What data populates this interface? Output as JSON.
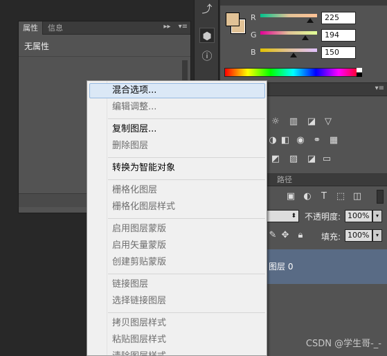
{
  "properties_panel": {
    "tabs": [
      "属性",
      "信息"
    ],
    "expand_glyph": "▸▸",
    "menu_glyph": "▾≡",
    "label": "无属性"
  },
  "color_panel": {
    "channels": [
      {
        "name": "R",
        "value": "225"
      },
      {
        "name": "G",
        "value": "194"
      },
      {
        "name": "B",
        "value": "150"
      }
    ],
    "foreground_color": "#e1c296",
    "menu_glyph": "▾≡"
  },
  "adjustments_panel": {
    "menu_glyph": "▾≡"
  },
  "layers_panel": {
    "tab": "路径",
    "opacity_label": "不透明度:",
    "opacity_value": "100%",
    "fill_label": "填充:",
    "fill_value": "100%",
    "layer_name": "图层 0"
  },
  "context_menu": {
    "items": [
      {
        "label": "混合选项...",
        "disabled": false
      },
      {
        "label": "编辑调整...",
        "disabled": true
      },
      {
        "label": "复制图层...",
        "disabled": false
      },
      {
        "label": "删除图层",
        "disabled": true
      },
      {
        "label": "转换为智能对象",
        "disabled": false
      },
      {
        "label": "栅格化图层",
        "disabled": true
      },
      {
        "label": "栅格化图层样式",
        "disabled": true
      },
      {
        "label": "启用图层蒙版",
        "disabled": true
      },
      {
        "label": "启用矢量蒙版",
        "disabled": true
      },
      {
        "label": "创建剪贴蒙版",
        "disabled": true
      },
      {
        "label": "链接图层",
        "disabled": true
      },
      {
        "label": "选择链接图层",
        "disabled": true
      },
      {
        "label": "拷贝图层样式",
        "disabled": true
      },
      {
        "label": "粘贴图层样式",
        "disabled": true
      },
      {
        "label": "清除图层样式",
        "disabled": true
      }
    ]
  },
  "watermark": "CSDN @学生哥-_-"
}
